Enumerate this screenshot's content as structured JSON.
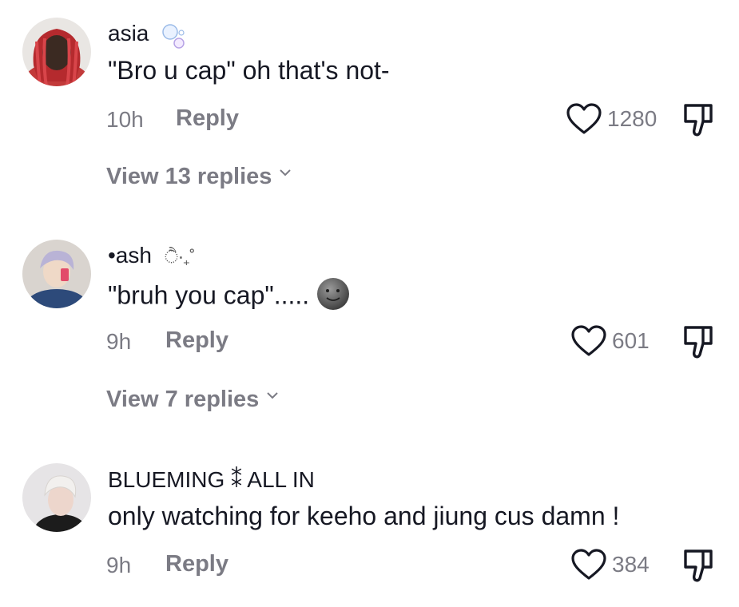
{
  "comments": [
    {
      "username": "asia",
      "username_deco": "bubbles-icon",
      "text": "\"Bro u cap\" oh that's not-",
      "time": "10h",
      "reply_label": "Reply",
      "likes": "1280",
      "view_replies": "View 13 replies"
    },
    {
      "username": "•ash",
      "username_deco_text": "ੈ‧₊˚",
      "text": "\"bruh you cap\".....",
      "emoji": "moon-face-icon",
      "time": "9h",
      "reply_label": "Reply",
      "likes": "601",
      "view_replies": "View 7 replies"
    },
    {
      "username": "BLUEMING ⁑ ALL IN",
      "text": "only watching for keeho and jiung cus damn !",
      "time": "9h",
      "reply_label": "Reply",
      "likes": "384"
    }
  ],
  "colors": {
    "text": "#161823",
    "muted": "#7b7b84"
  }
}
